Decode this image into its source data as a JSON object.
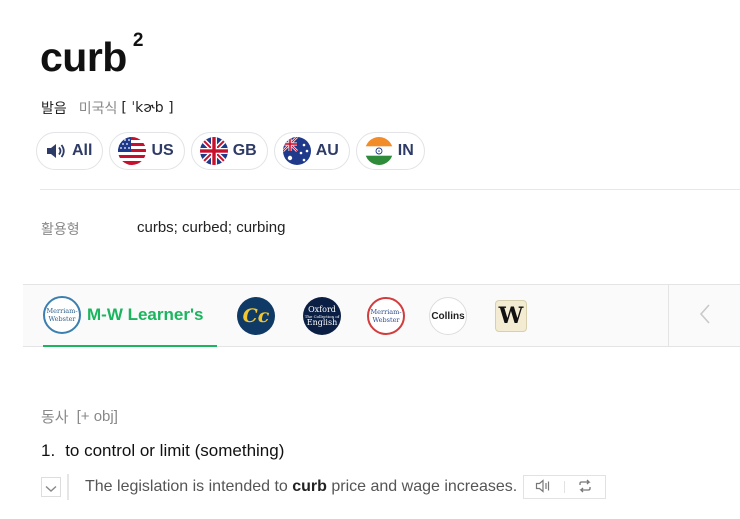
{
  "entry": {
    "word": "curb",
    "homograph": "2"
  },
  "pronunciation": {
    "label": "발음",
    "dialect": "미국식",
    "ipa": "[ ˈkɚb ]"
  },
  "audio_buttons": [
    {
      "label": "All",
      "icon": "speaker-icon"
    },
    {
      "label": "US",
      "icon": "us-flag-icon"
    },
    {
      "label": "GB",
      "icon": "gb-flag-icon"
    },
    {
      "label": "AU",
      "icon": "au-flag-icon"
    },
    {
      "label": "IN",
      "icon": "in-flag-icon"
    }
  ],
  "inflections": {
    "label": "활용형",
    "value": "curbs; curbed; curbing"
  },
  "dictionaries": {
    "active_label": "M-W Learner's",
    "mw_logo_line1": "Merriam-",
    "mw_logo_line2": "Webster",
    "cc_logo": "Cc",
    "ox_line1": "Oxford",
    "ox_line2": "The Collection of",
    "ox_line3": "English",
    "collins_logo": "Collins",
    "w_logo": "W"
  },
  "sense": {
    "pos": "동사",
    "grammar": "[+ obj]",
    "number": "1.",
    "definition": "to control or limit (something)",
    "example_before": "The legislation is intended to ",
    "example_bold": "curb",
    "example_after": " price and wage increases."
  },
  "colors": {
    "accent_green": "#1ab55e",
    "label_navy": "#2e3b66"
  }
}
